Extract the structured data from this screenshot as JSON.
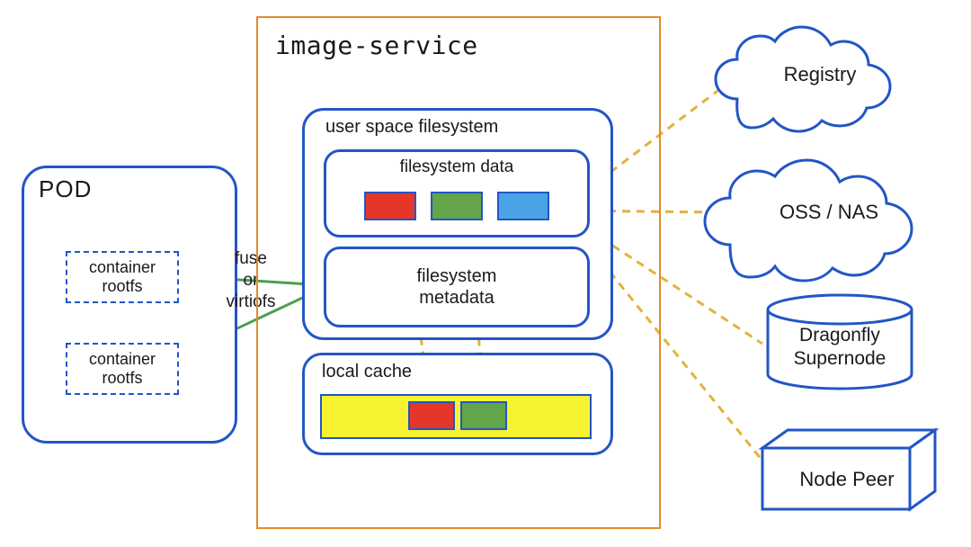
{
  "pod": {
    "title": "POD",
    "containers": [
      {
        "label": "container\nrootfs"
      },
      {
        "label": "container\nrootfs"
      }
    ]
  },
  "connector": {
    "fuse_label": "fuse\nor\nvirtiofs"
  },
  "image_service": {
    "title": "image-service",
    "user_space_fs": {
      "title": "user space filesystem",
      "fs_data": {
        "title": "filesystem data",
        "blocks": [
          "red",
          "green",
          "blue"
        ]
      },
      "fs_metadata": {
        "title": "filesystem\nmetadata"
      }
    },
    "local_cache": {
      "title": "local cache",
      "cached_blocks": [
        "red",
        "green"
      ]
    }
  },
  "backends": {
    "registry": {
      "label": "Registry"
    },
    "oss_nas": {
      "label": "OSS / NAS"
    },
    "dragonfly": {
      "label": "Dragonfly\nSupernode"
    },
    "node_peer": {
      "label": "Node Peer"
    }
  },
  "colors": {
    "blue_border": "#2256c6",
    "orange_border": "#e38b2d",
    "dash_gold": "#e2b33a",
    "arrow_green": "#4aa14d",
    "chip_red": "#e4372a",
    "chip_green": "#64a44a",
    "chip_blue": "#4aa3e4",
    "cache_yellow": "#f7f232"
  }
}
